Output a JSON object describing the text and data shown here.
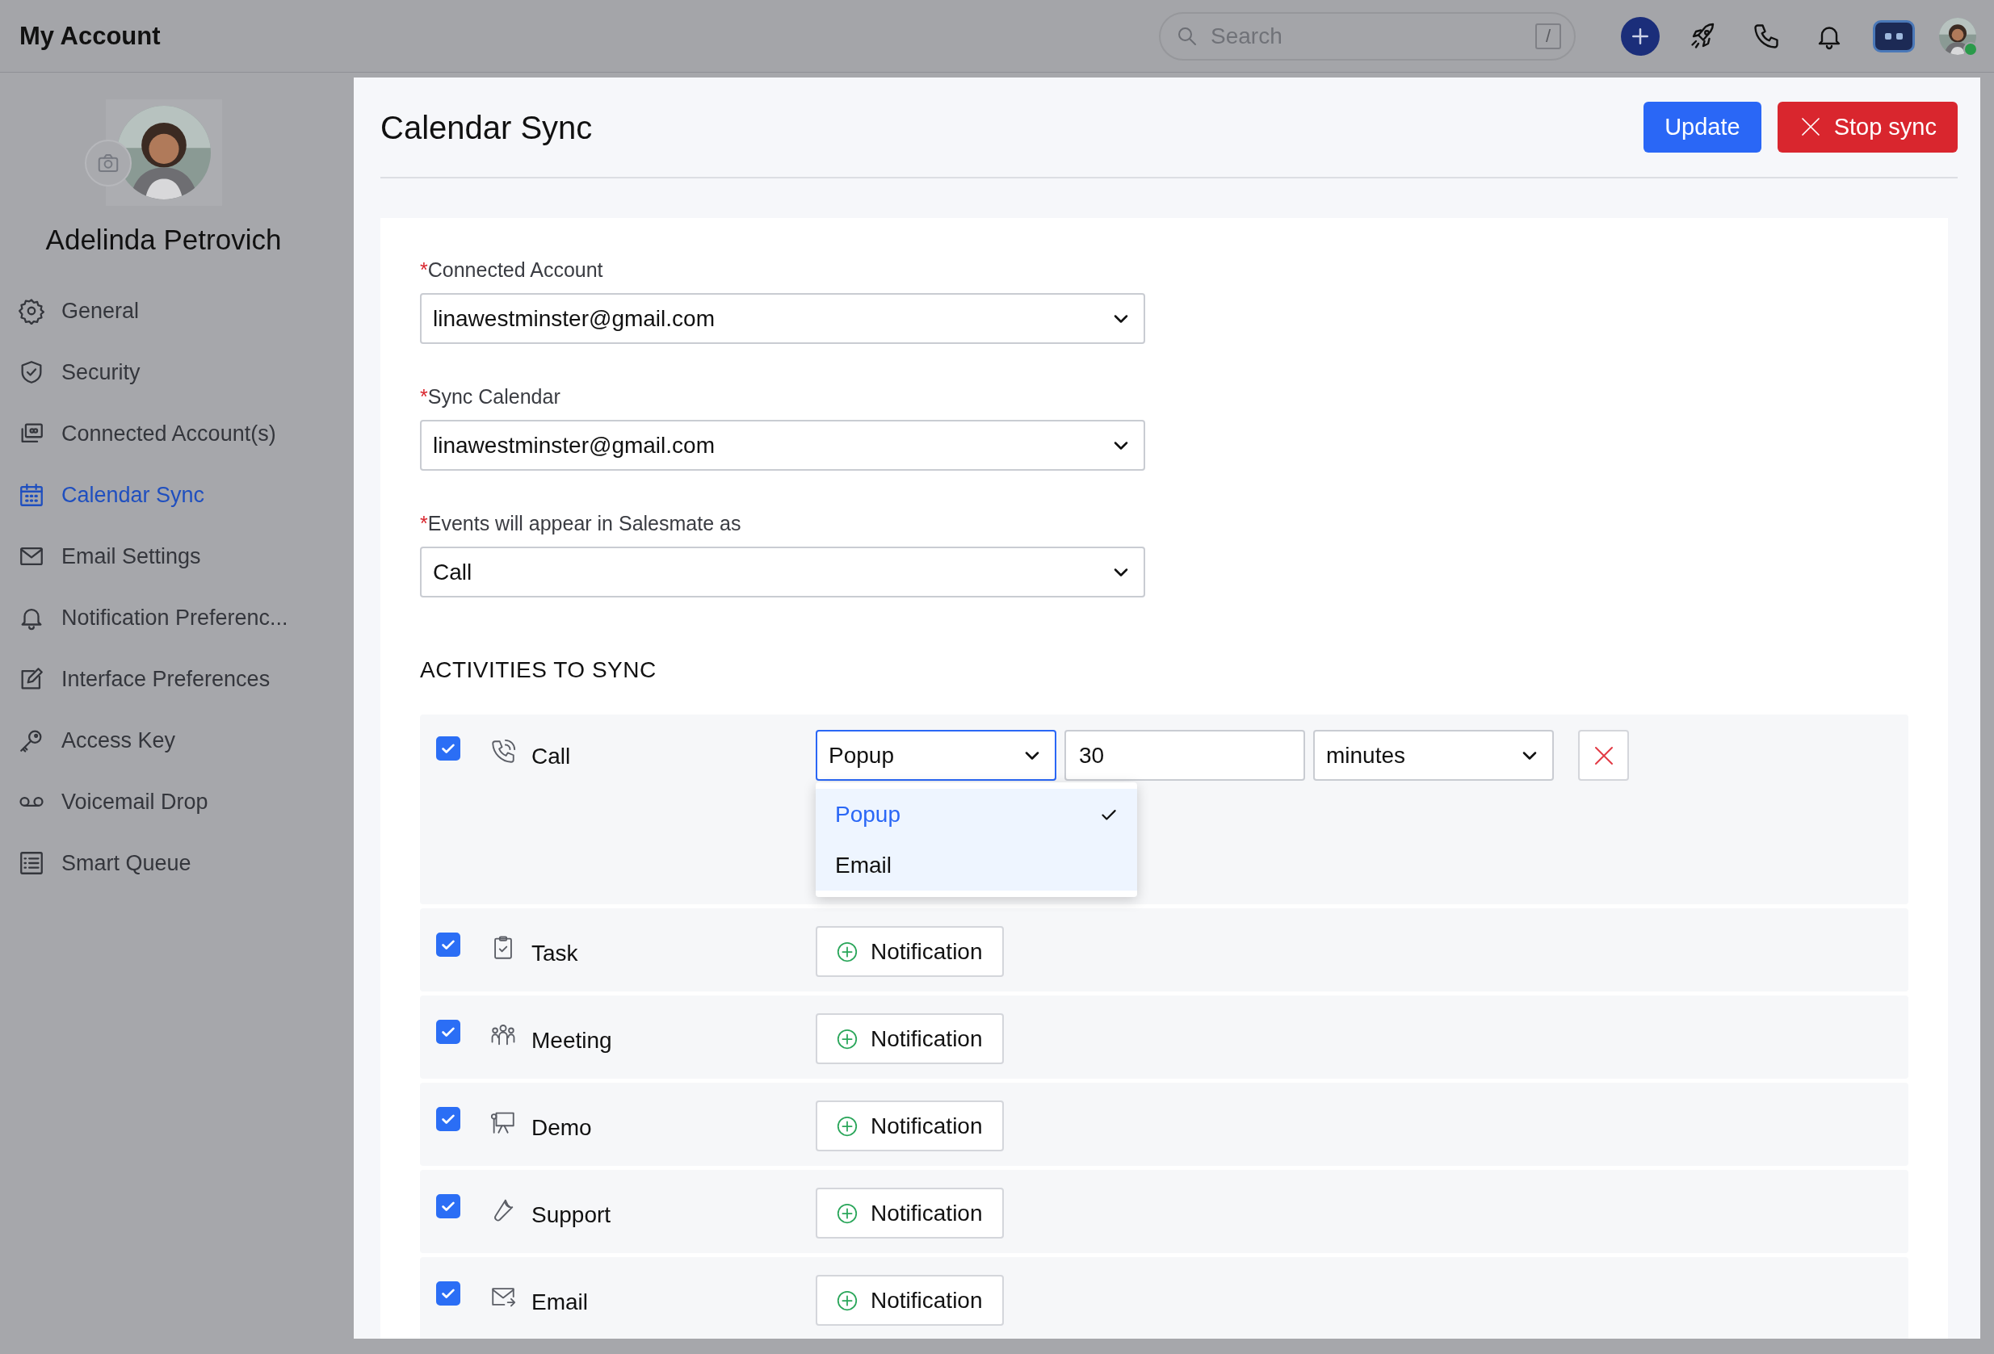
{
  "header": {
    "title": "My Account",
    "search": {
      "placeholder": "Search",
      "shortcut": "/"
    },
    "user": {
      "online": true
    }
  },
  "profile": {
    "name": "Adelinda Petrovich"
  },
  "sidebar": {
    "items": [
      {
        "label": "General",
        "selected": false
      },
      {
        "label": "Security",
        "selected": false
      },
      {
        "label": "Connected Account(s)",
        "selected": false
      },
      {
        "label": "Calendar Sync",
        "selected": true
      },
      {
        "label": "Email Settings",
        "selected": false
      },
      {
        "label": "Notification Preferenc...",
        "selected": false
      },
      {
        "label": "Interface Preferences",
        "selected": false
      },
      {
        "label": "Access Key",
        "selected": false
      },
      {
        "label": "Voicemail Drop",
        "selected": false
      },
      {
        "label": "Smart Queue",
        "selected": false
      }
    ]
  },
  "page": {
    "title": "Calendar Sync",
    "buttons": [
      {
        "label": "Update",
        "kind": "primary"
      },
      {
        "label": "Stop sync",
        "kind": "danger"
      }
    ]
  },
  "form": {
    "fields": [
      {
        "mark": "*",
        "label": "Connected Account",
        "value": "linawestminster@gmail.com"
      },
      {
        "mark": "*",
        "label": "Sync Calendar",
        "value": "linawestminster@gmail.com"
      },
      {
        "mark": "*",
        "label": "Events will appear in Salesmate as",
        "value": "Call"
      }
    ]
  },
  "activities": {
    "title": "ACTIVITIES TO SYNC",
    "rows": [
      {
        "label": "Call",
        "checked": true,
        "kind": "reminder",
        "reminder": {
          "type": "Popup",
          "open": true,
          "amount": "30",
          "unit": "minutes",
          "menu": [
            {
              "label": "Popup",
              "selected": true
            },
            {
              "label": "Email",
              "selected": false
            }
          ]
        }
      },
      {
        "label": "Task",
        "checked": true,
        "kind": "add",
        "button": "Notification"
      },
      {
        "label": "Meeting",
        "checked": true,
        "kind": "add",
        "button": "Notification"
      },
      {
        "label": "Demo",
        "checked": true,
        "kind": "add",
        "button": "Notification"
      },
      {
        "label": "Support",
        "checked": true,
        "kind": "add",
        "button": "Notification"
      },
      {
        "label": "Email",
        "checked": true,
        "kind": "add",
        "button": "Notification"
      }
    ]
  }
}
